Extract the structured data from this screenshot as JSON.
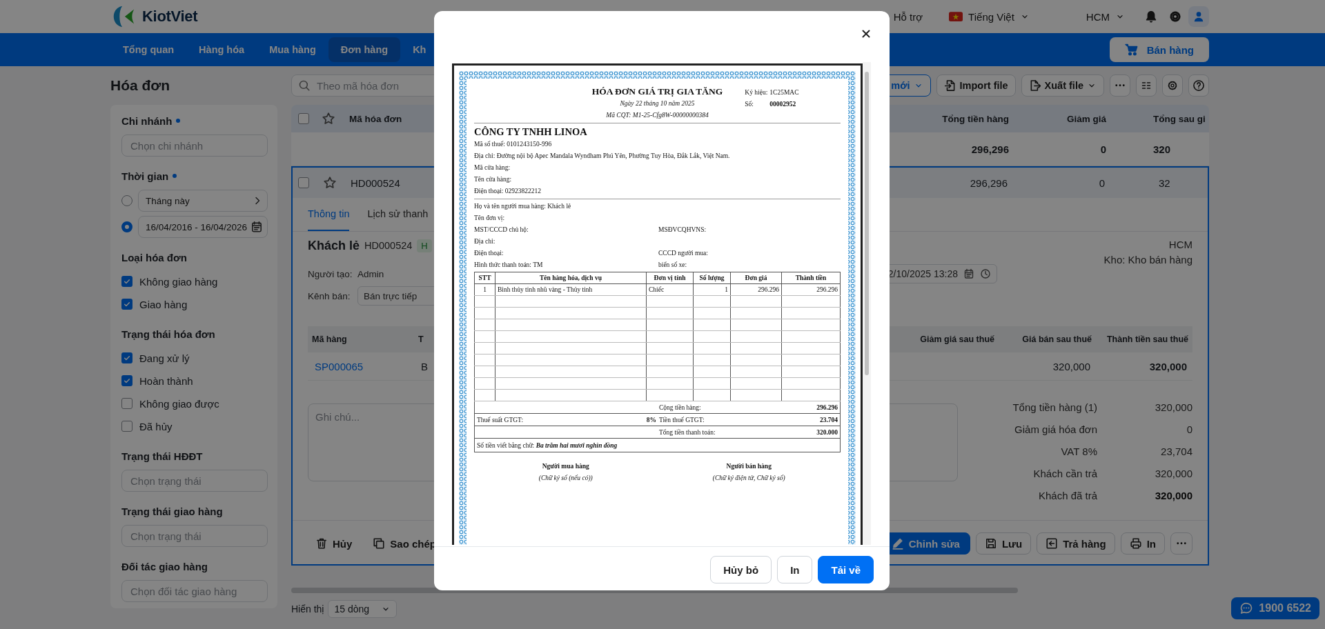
{
  "topbar": {
    "brand": "KiotViet",
    "support": "Hỗ trợ",
    "language": "Tiếng Việt",
    "branch": "HCM"
  },
  "nav": {
    "items": [
      {
        "label": "Tổng quan",
        "selected": false
      },
      {
        "label": "Hàng hóa",
        "selected": false
      },
      {
        "label": "Mua hàng",
        "selected": false
      },
      {
        "label": "Đơn hàng",
        "selected": true
      },
      {
        "label": "Kh",
        "selected": false
      }
    ],
    "sell_button": "Bán hàng"
  },
  "page_title": "Hóa đơn",
  "search": {
    "placeholder": "Theo mã hóa đơn"
  },
  "toolbar": {
    "new_button": "mới",
    "import_button": "Import file",
    "export_button": "Xuất file"
  },
  "filters": [
    {
      "kind": "field",
      "title": "Chi nhánh",
      "required": true,
      "placeholder": "Chọn chi nhánh"
    },
    {
      "kind": "time",
      "title": "Thời gian",
      "required": true,
      "options": [
        {
          "kind": "preset",
          "label": "Tháng này",
          "selected": false
        },
        {
          "kind": "range",
          "label": "16/04/2016 - 16/04/2026",
          "selected": true
        }
      ]
    },
    {
      "kind": "checks",
      "title": "Loại hóa đơn",
      "required": false,
      "options": [
        {
          "label": "Không giao hàng",
          "checked": true
        },
        {
          "label": "Giao hàng",
          "checked": true
        }
      ]
    },
    {
      "kind": "checks",
      "title": "Trạng thái hóa đơn",
      "required": false,
      "options": [
        {
          "label": "Đang xử lý",
          "checked": true
        },
        {
          "label": "Hoàn thành",
          "checked": true
        },
        {
          "label": "Không giao được",
          "checked": false
        },
        {
          "label": "Đã hủy",
          "checked": false
        }
      ]
    },
    {
      "kind": "field",
      "title": "Trạng thái HĐĐT",
      "required": false,
      "placeholder": "Chọn trạng thái"
    },
    {
      "kind": "field",
      "title": "Trạng thái giao hàng",
      "required": false,
      "placeholder": "Chọn trạng thái"
    },
    {
      "kind": "field",
      "title": "Đối tác giao hàng",
      "required": false,
      "placeholder": "Chọn đối tác giao hàng"
    }
  ],
  "table": {
    "select_all": false,
    "columns": [
      "Mã hóa đơn",
      "Tổng tiền hàng",
      "Giảm giá",
      "Tổng sau gi"
    ],
    "summary": {
      "subtotal": "296,296",
      "discount": "0",
      "after_discount": "320"
    },
    "rows": [
      {
        "checked": false,
        "cells": [
          "HD000524",
          "296,296",
          "0",
          "32"
        ],
        "selected": true
      }
    ]
  },
  "detail": {
    "tabs": [
      {
        "label": "Thông tin",
        "selected": true
      },
      {
        "label": "Lịch sử thanh",
        "selected": false
      }
    ],
    "customer": "Khách lẻ",
    "code": "HD000524",
    "status_badge": "H",
    "branch": "HCM",
    "warehouse": "Kho: Kho bán hàng",
    "creator_label": "Người tạo:",
    "creator": "Admin",
    "channel_label": "Kênh bán:",
    "channel": "Bán trực tiếp",
    "date": "2/10/2025 13:28",
    "item_columns": [
      "Mã hàng",
      "T",
      "Giảm giá sau thuế",
      "Giá bán sau thuế",
      "Thành tiền sau thuế"
    ],
    "items": [
      {
        "code": "SP000065",
        "name": "B",
        "price": "320,000",
        "total": "320,000"
      }
    ],
    "note": {
      "placeholder": "Ghi chú..."
    },
    "totals": [
      {
        "label": "Tổng tiền hàng (1)",
        "value": "320,000",
        "bold": false
      },
      {
        "label": "Giảm giá hóa đơn",
        "value": "0",
        "bold": false
      },
      {
        "label": "VAT 8%",
        "value": "23,704",
        "bold": false
      },
      {
        "label": "Khách cần trả",
        "value": "320,000",
        "bold": false
      },
      {
        "label": "Khách đã trả",
        "value": "320,000",
        "bold": true
      }
    ],
    "left_actions": [
      {
        "kind": "delete",
        "label": "Hủy"
      },
      {
        "kind": "copy",
        "label": "Sao chép"
      }
    ],
    "right_actions": [
      {
        "kind": "edit",
        "label": "Chỉnh sửa"
      },
      {
        "kind": "save",
        "label": "Lưu"
      },
      {
        "kind": "return",
        "label": "Trả hàng"
      },
      {
        "kind": "print",
        "label": "In"
      },
      {
        "kind": "more"
      }
    ]
  },
  "pagination": {
    "label": "Hiển thị",
    "value": "15 dòng"
  },
  "hotline": "1900 6522",
  "modal": {
    "buttons": [
      {
        "kind": "secondary",
        "label": "Hủy bỏ"
      },
      {
        "kind": "secondary",
        "label": "In"
      },
      {
        "kind": "primary",
        "label": "Tải về"
      }
    ],
    "invoice": {
      "title": "HÓA ĐƠN GIÁ TRỊ GIA TĂNG",
      "date": "Ngày 22 tháng 10 năm 2025",
      "authority_code": "Mã CQT: M1-25-Cfg8W-00000000384",
      "meta": [
        {
          "label": "Ký hiệu:",
          "value": "1C25MAC",
          "bold": false
        },
        {
          "label": "Số:",
          "value": "00002952",
          "bold": true
        }
      ],
      "seller": "CÔNG TY TNHH LINOA",
      "seller_lines": [
        "Mã số thuế: 0101243150-996",
        "Địa chỉ: Đường nội bộ Apec Mandala Wyndham Phú Yên, Phường Tuy Hòa, Đắk Lắk, Việt Nam.",
        "Mã cửa hàng:",
        "Tên cửa hàng:",
        "Điện thoại: 02923822212"
      ],
      "buyer_lines": [
        {
          "left": "Họ và tên người mua hàng: Khách lẻ"
        },
        {
          "left": "Tên đơn vị:"
        },
        {
          "left": "MST/CCCD chủ hộ:",
          "right": "MSĐVCQHVNS:"
        },
        {
          "left": "Địa chỉ:"
        },
        {
          "left": "Điện thoại:",
          "right": "CCCD người mua:"
        },
        {
          "left": "Hình thức thanh toán: TM",
          "right": "biển số xe:"
        }
      ],
      "columns": [
        "STT",
        "Tên hàng hóa, dịch vụ",
        "Đơn vị tính",
        "Số lượng",
        "Đơn giá",
        "Thành tiền"
      ],
      "rows": [
        [
          "1",
          "Bình thủy tinh nhũ vàng - Thủy tinh",
          "Chiếc",
          "1",
          "296.296",
          "296.296"
        ]
      ],
      "subtotal": {
        "label": "Cộng tiền hàng:",
        "value": "296.296"
      },
      "vat": {
        "rate_label": "Thuế suất GTGT:",
        "rate": "8%",
        "label": "Tiền thuế GTGT:",
        "value": "23.704"
      },
      "total": {
        "label": "Tổng tiền thanh toán:",
        "value": "320.000"
      },
      "in_words": "Số tiền viết bằng chữ: **Ba trăm hai mươi nghìn đồng**",
      "signatures": [
        {
          "title": "Người mua hàng",
          "note": "(Chữ ký số (nếu có))"
        },
        {
          "title": "Người bán hàng",
          "note": "(Chữ ký điện tử, Chữ ký số)"
        }
      ]
    }
  }
}
